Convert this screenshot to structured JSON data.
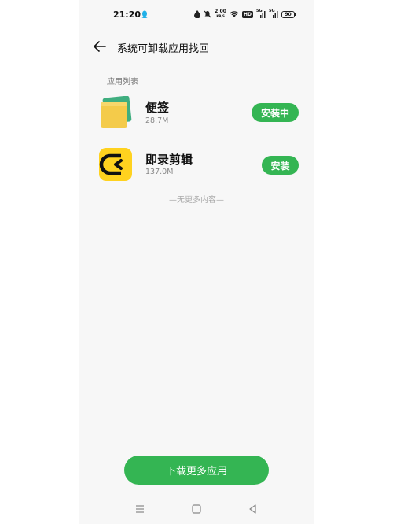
{
  "status_bar": {
    "time": "21:20",
    "net_speed_value": "2.00",
    "net_speed_unit": "KB/S",
    "hd_badge": "HD",
    "signal1_label": "5G",
    "signal2_label": "5G",
    "battery": "90"
  },
  "header": {
    "title": "系统可卸载应用找回"
  },
  "section_label": "应用列表",
  "apps": [
    {
      "name": "便签",
      "size": "28.7M",
      "button": "安装中"
    },
    {
      "name": "即录剪辑",
      "size": "137.0M",
      "button": "安装"
    }
  ],
  "no_more_text": "—无更多内容—",
  "download_button": "下载更多应用",
  "colors": {
    "accent_green": "#34b553",
    "background": "#f7f7f7",
    "notes_yellow": "#f4cb4a",
    "notes_green": "#3fae7f",
    "clip_yellow": "#ffd21f"
  }
}
